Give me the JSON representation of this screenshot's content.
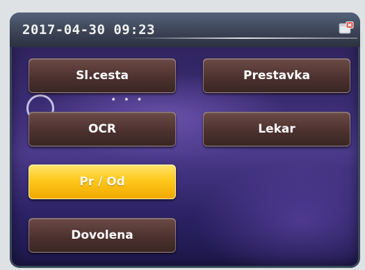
{
  "status_bar": {
    "datetime": "2017-04-30 09:23",
    "corner_icon": "exit-window-icon"
  },
  "menu": {
    "buttons": [
      {
        "label": "Sl.cesta",
        "selected": false
      },
      {
        "label": "Prestavka",
        "selected": false
      },
      {
        "label": "OCR",
        "selected": false
      },
      {
        "label": "Lekar",
        "selected": false
      },
      {
        "label": "Pr / Od",
        "selected": true
      },
      {
        "label": "Dovolena",
        "selected": false
      }
    ]
  },
  "colors": {
    "background": "#3a2c73",
    "button": "#4a302d",
    "selected_button": "#ffc81c",
    "titlebar": "#3c4456"
  }
}
